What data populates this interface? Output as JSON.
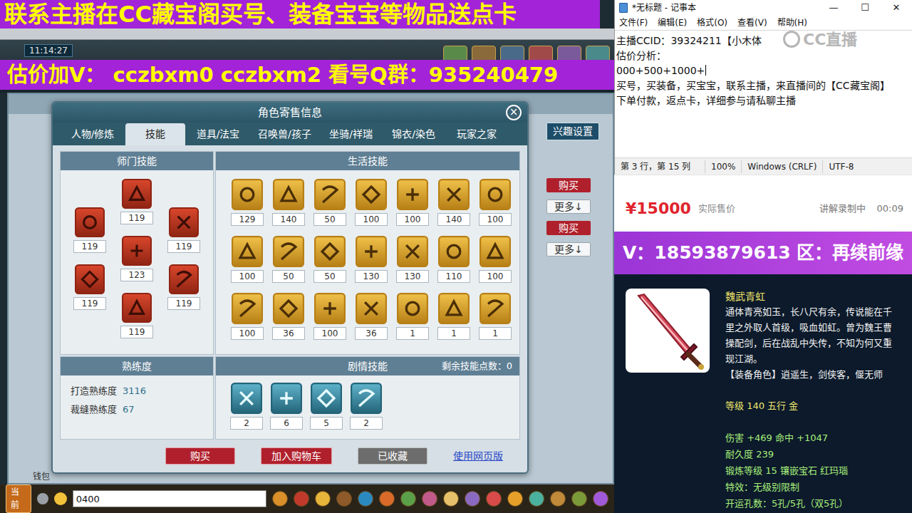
{
  "overlay": {
    "top_banner": "联系主播在CC藏宝阁买号、装备宝宝等物品送点卡",
    "contact_banner": "估价加V： cczbxm0 cczbxm2 看号Q群：935240479"
  },
  "game": {
    "clock": "11:14:27",
    "interest_button": "兴趣设置",
    "listing_actions": [
      {
        "buy": "购买",
        "more": "更多↓"
      },
      {
        "buy": "购买",
        "more": "更多↓"
      }
    ],
    "wallet": "钱包",
    "chat_channel": "当前",
    "chat_input": "0400"
  },
  "dialog": {
    "title": "角色寄售信息",
    "close": "×",
    "tabs": [
      {
        "label": "人物/修炼",
        "selected": false
      },
      {
        "label": "技能",
        "selected": true
      },
      {
        "label": "道具/法宝",
        "selected": false
      },
      {
        "label": "召唤兽/孩子",
        "selected": false
      },
      {
        "label": "坐骑/祥瑞",
        "selected": false
      },
      {
        "label": "锦衣/染色",
        "selected": false
      },
      {
        "label": "玩家之家",
        "selected": false
      }
    ],
    "school_skills": {
      "title": "师门技能",
      "levels": [
        "119",
        "119",
        "119",
        "123",
        "119",
        "119",
        "119"
      ]
    },
    "life_skills": {
      "title": "生活技能",
      "levels": [
        "129",
        "140",
        "50",
        "100",
        "100",
        "140",
        "100",
        "100",
        "50",
        "50",
        "130",
        "130",
        "110",
        "100",
        "100",
        "36",
        "100",
        "36",
        "1",
        "1",
        "1"
      ]
    },
    "proficiency": {
      "title": "熟练度",
      "rows": [
        {
          "label": "打造熟练度",
          "value": "3116"
        },
        {
          "label": "裁缝熟练度",
          "value": "67"
        }
      ]
    },
    "plot_skills": {
      "title": "剧情技能",
      "remaining_label": "剩余技能点数：",
      "remaining": "0",
      "levels": [
        "2",
        "6",
        "5",
        "2"
      ]
    },
    "buttons": [
      {
        "label": "购买",
        "kind": "buy"
      },
      {
        "label": "加入购物车",
        "kind": "cart"
      },
      {
        "label": "已收藏",
        "kind": "favorited"
      },
      {
        "label": "使用网页版",
        "kind": "link"
      }
    ]
  },
  "notepad": {
    "title": "*无标题 - 记事本",
    "window_controls": [
      "—",
      "☐",
      "✕"
    ],
    "menu": [
      "文件(F)",
      "编辑(E)",
      "格式(O)",
      "查看(V)",
      "帮助(H)"
    ],
    "lines": [
      {
        "text": "主播CCID：39324211【小木体",
        "caret": false
      },
      {
        "text": "估价分析：",
        "caret": false
      },
      {
        "text": "000+500+1000+",
        "caret": true
      },
      {
        "text": "买号，买装备，买宝宝，联系主播，来直播间的【CC藏宝阁】下单付款，返点卡，详细参与请私聊主播",
        "caret": false
      }
    ],
    "watermark": "CC直播",
    "status": [
      "第 3 行，第 15 列",
      "100%",
      "Windows (CRLF)",
      "UTF-8"
    ]
  },
  "price": {
    "amount": "¥15000",
    "label": "实际售价",
    "recording": "讲解录制中",
    "timer": "00:09"
  },
  "item": {
    "banner": "V：18593879613 区：再续前缘",
    "name": "魏武青虹",
    "description": "通体青亮如玉，长八尺有余，传说能在千里之外取人首级，吸血如虹。曾为魏王曹操配剑，后在战乱中失传，不知为何又重现江湖。",
    "roles": "【装备角色】逍遥生，剑侠客，偃无师",
    "lines": [
      {
        "text": "等级 140 五行 金",
        "kind": "basic"
      },
      {
        "text": "伤害 +469 命中 +1047",
        "kind": "stat"
      },
      {
        "text": "耐久度 239",
        "kind": "stat"
      },
      {
        "text": "锻炼等级 15 镶嵌宝石 红玛瑙",
        "kind": "stat"
      },
      {
        "text": "特效：无级别限制",
        "kind": "stat"
      },
      {
        "text": "开运孔数：5孔/5孔（双5孔）",
        "kind": "stat"
      }
    ]
  }
}
